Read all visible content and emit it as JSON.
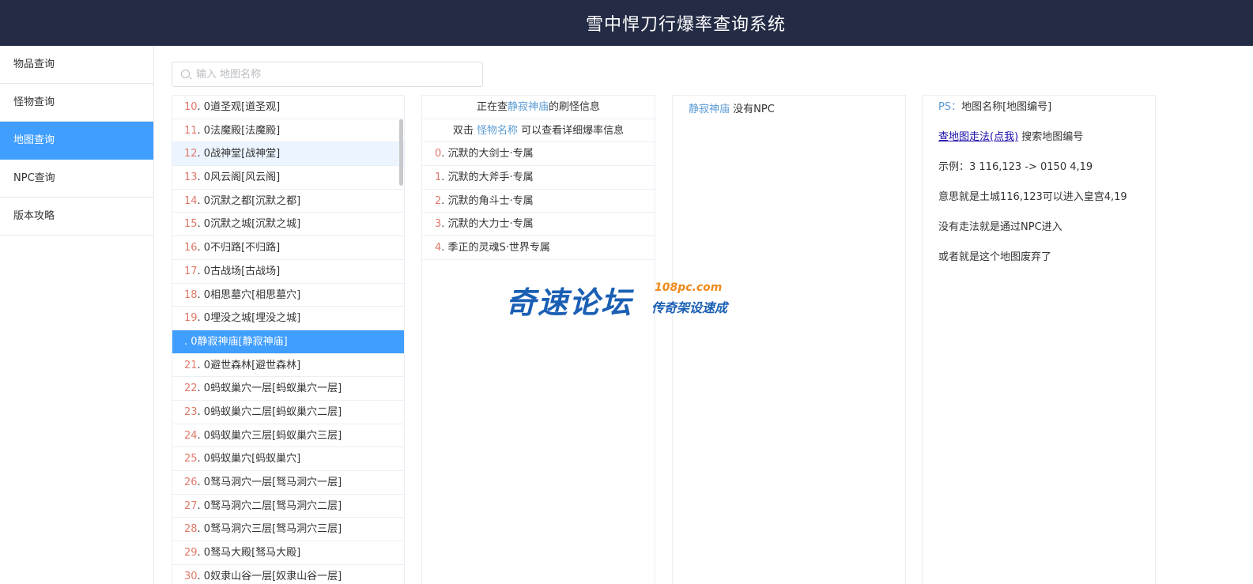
{
  "header": {
    "title": "雪中悍刀行爆率查询系统"
  },
  "sidebar": {
    "items": [
      {
        "label": "物品查询"
      },
      {
        "label": "怪物查询"
      },
      {
        "label": "地图查询"
      },
      {
        "label": "NPC查询"
      },
      {
        "label": "版本攻略"
      }
    ],
    "active_index": 2
  },
  "search": {
    "placeholder": "输入 地图名称",
    "value": ""
  },
  "map_list": {
    "rows": [
      {
        "idx": "10",
        "text": ". 0道圣观[道圣观]"
      },
      {
        "idx": "11",
        "text": ". 0法魔殿[法魔殿]"
      },
      {
        "idx": "12",
        "text": ". 0战神堂[战神堂]"
      },
      {
        "idx": "13",
        "text": ". 0风云阁[风云阁]"
      },
      {
        "idx": "14",
        "text": ". 0沉默之都[沉默之都]"
      },
      {
        "idx": "15",
        "text": ". 0沉默之城[沉默之城]"
      },
      {
        "idx": "16",
        "text": ". 0不归路[不归路]"
      },
      {
        "idx": "17",
        "text": ". 0古战场[古战场]"
      },
      {
        "idx": "18",
        "text": ". 0相思墓穴[相思墓穴]"
      },
      {
        "idx": "19",
        "text": ". 0埋没之城[埋没之城]"
      },
      {
        "idx": "",
        "text": ". 0静寂神庙[静寂神庙]"
      },
      {
        "idx": "21",
        "text": ". 0避世森林[避世森林]"
      },
      {
        "idx": "22",
        "text": ". 0蚂蚁巢穴一层[蚂蚁巢穴一层]"
      },
      {
        "idx": "23",
        "text": ". 0蚂蚁巢穴二层[蚂蚁巢穴二层]"
      },
      {
        "idx": "24",
        "text": ". 0蚂蚁巢穴三层[蚂蚁巢穴三层]"
      },
      {
        "idx": "25",
        "text": ". 0蚂蚁巢穴[蚂蚁巢穴]"
      },
      {
        "idx": "26",
        "text": ". 0驽马洞穴一层[驽马洞穴一层]"
      },
      {
        "idx": "27",
        "text": ". 0驽马洞穴二层[驽马洞穴二层]"
      },
      {
        "idx": "28",
        "text": ". 0驽马洞穴三层[驽马洞穴三层]"
      },
      {
        "idx": "29",
        "text": ". 0驽马大殿[驽马大殿]"
      },
      {
        "idx": "30",
        "text": ". 0奴隶山谷一层[奴隶山谷一层]"
      }
    ],
    "hover_index": 2,
    "selected_index": 10
  },
  "monster_panel": {
    "line1_prefix": "正在查",
    "map_name": "静寂神庙",
    "line1_suffix": "的刷怪信息",
    "line2_prefix": "双击",
    "line2_link": "怪物名称",
    "line2_suffix": "可以查看详细爆率信息",
    "monsters": [
      {
        "idx": "0",
        "text": ". 沉默的大剑士·专属"
      },
      {
        "idx": "1",
        "text": ". 沉默的大斧手·专属"
      },
      {
        "idx": "2",
        "text": ". 沉默的角斗士·专属"
      },
      {
        "idx": "3",
        "text": ". 沉默的大力士·专属"
      },
      {
        "idx": "4",
        "text": ". 季正的灵魂S·世界专属"
      }
    ]
  },
  "npc_panel": {
    "map_name": "静寂神庙",
    "text": "没有NPC"
  },
  "info_panel": {
    "ps_label": "PS：",
    "ps_text": "地图名称[地图编号]",
    "link_text": "查地图走法(点我)",
    "link_suffix": "搜索地图编号",
    "example": "示例：3 116,123 -> 0150 4,19",
    "meaning": "意思就是土城116,123可以进入皇宫4,19",
    "no_route": "没有走法就是通过NPC进入",
    "abandoned": "或者就是这个地图废弃了"
  },
  "watermark": {
    "main": "奇速论坛",
    "url": "108pc.com",
    "sub": "传奇架设速成"
  },
  "colors": {
    "header_bg": "#232b45",
    "accent": "#409eff",
    "index_color": "#e07a6a",
    "link_blue": "#5b9bd5"
  }
}
